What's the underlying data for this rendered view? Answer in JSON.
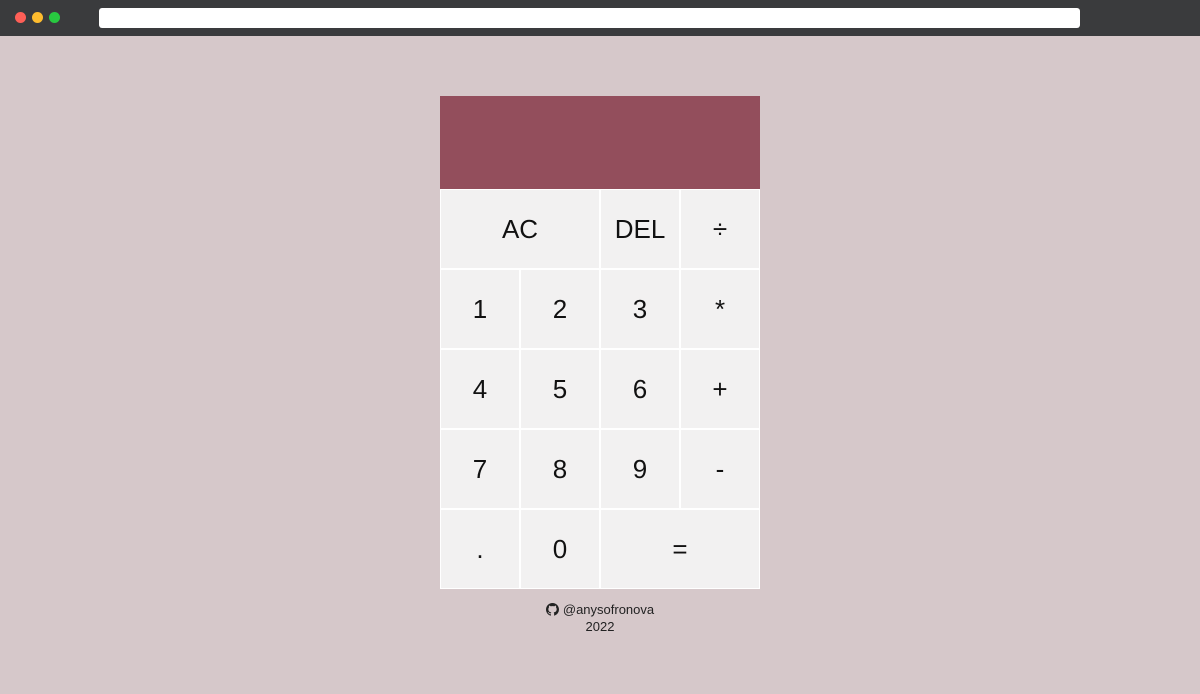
{
  "browser": {
    "controls": [
      "close",
      "minimize",
      "maximize"
    ]
  },
  "calculator": {
    "display_value": "",
    "display_color": "#934e5c",
    "keys": [
      {
        "label": "AC",
        "wide": true,
        "name": "clear-button"
      },
      {
        "label": "DEL",
        "wide": false,
        "name": "delete-button"
      },
      {
        "label": "÷",
        "wide": false,
        "name": "divide-button"
      },
      {
        "label": "1",
        "wide": false,
        "name": "digit-1-button"
      },
      {
        "label": "2",
        "wide": false,
        "name": "digit-2-button"
      },
      {
        "label": "3",
        "wide": false,
        "name": "digit-3-button"
      },
      {
        "label": "*",
        "wide": false,
        "name": "multiply-button"
      },
      {
        "label": "4",
        "wide": false,
        "name": "digit-4-button"
      },
      {
        "label": "5",
        "wide": false,
        "name": "digit-5-button"
      },
      {
        "label": "6",
        "wide": false,
        "name": "digit-6-button"
      },
      {
        "label": "+",
        "wide": false,
        "name": "plus-button"
      },
      {
        "label": "7",
        "wide": false,
        "name": "digit-7-button"
      },
      {
        "label": "8",
        "wide": false,
        "name": "digit-8-button"
      },
      {
        "label": "9",
        "wide": false,
        "name": "digit-9-button"
      },
      {
        "label": "-",
        "wide": false,
        "name": "minus-button"
      },
      {
        "label": ".",
        "wide": false,
        "name": "decimal-button"
      },
      {
        "label": "0",
        "wide": false,
        "name": "digit-0-button"
      },
      {
        "label": "=",
        "wide": true,
        "name": "equals-button"
      }
    ]
  },
  "footer": {
    "icon": "github-icon",
    "author": "@anysofronova",
    "year": "2022"
  }
}
